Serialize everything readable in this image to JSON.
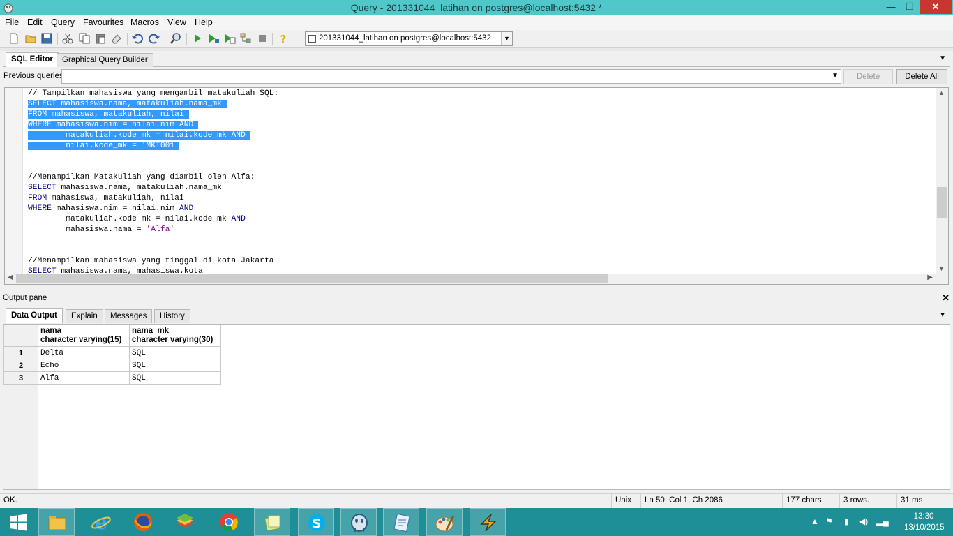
{
  "window": {
    "title": "Query - 201331044_latihan on postgres@localhost:5432 *",
    "minimize": "—",
    "maximize": "❐",
    "close": "✕"
  },
  "menu": [
    "File",
    "Edit",
    "Query",
    "Favourites",
    "Macros",
    "View",
    "Help"
  ],
  "toolbar": {
    "icons": [
      "new-icon",
      "open-icon",
      "save-icon",
      "cut-icon",
      "copy-icon",
      "paste-icon",
      "clear-icon",
      "undo-icon",
      "redo-icon",
      "find-icon",
      "execute-icon",
      "execute-pgscript-icon",
      "execute-to-file-icon",
      "explain-icon",
      "cancel-icon",
      "help-icon"
    ],
    "connection": "201331044_latihan on postgres@localhost:5432"
  },
  "editor_tabs": [
    "SQL Editor",
    "Graphical Query Builder"
  ],
  "previous_queries": {
    "label": "Previous queries",
    "value": "",
    "delete": "Delete",
    "delete_all": "Delete All"
  },
  "editor": {
    "lines": [
      {
        "segments": [
          {
            "t": "// Tampilkan mahasiswa yang mengambil matakuliah SQL:",
            "c": "plain"
          }
        ]
      },
      {
        "segments": [
          {
            "t": "SELECT",
            "c": "kw sel"
          },
          {
            "t": " mahasiswa.nama, matakuliah.nama_mk ",
            "c": "sel"
          }
        ]
      },
      {
        "segments": [
          {
            "t": "FROM",
            "c": "kw sel"
          },
          {
            "t": " mahasiswa, matakuliah, nilai ",
            "c": "sel"
          }
        ]
      },
      {
        "segments": [
          {
            "t": "WHERE",
            "c": "kw sel"
          },
          {
            "t": " mahasiswa.nim = nilai.nim ",
            "c": "sel"
          },
          {
            "t": "AND",
            "c": "kw sel"
          },
          {
            "t": " ",
            "c": "sel"
          }
        ]
      },
      {
        "segments": [
          {
            "t": "        matakuliah.kode_mk = nilai.kode_mk ",
            "c": "sel"
          },
          {
            "t": "AND",
            "c": "kw sel"
          },
          {
            "t": " ",
            "c": "sel"
          }
        ]
      },
      {
        "segments": [
          {
            "t": "        nilai.kode_mk = 'MKI001'",
            "c": "sel"
          }
        ]
      },
      {
        "segments": []
      },
      {
        "segments": []
      },
      {
        "segments": [
          {
            "t": "//Menampilkan Matakuliah yang diambil oleh Alfa:",
            "c": "plain"
          }
        ]
      },
      {
        "segments": [
          {
            "t": "SELECT",
            "c": "kw"
          },
          {
            "t": " mahasiswa.nama, matakuliah.nama_mk",
            "c": "plain"
          }
        ]
      },
      {
        "segments": [
          {
            "t": "FROM",
            "c": "kw"
          },
          {
            "t": " mahasiswa, matakuliah, nilai",
            "c": "plain"
          }
        ]
      },
      {
        "segments": [
          {
            "t": "WHERE",
            "c": "kw"
          },
          {
            "t": " mahasiswa.nim = nilai.nim ",
            "c": "plain"
          },
          {
            "t": "AND",
            "c": "kw"
          }
        ]
      },
      {
        "segments": [
          {
            "t": "        matakuliah.kode_mk = nilai.kode_mk ",
            "c": "plain"
          },
          {
            "t": "AND",
            "c": "kw"
          }
        ]
      },
      {
        "segments": [
          {
            "t": "        mahasiswa.nama = ",
            "c": "plain"
          },
          {
            "t": "'Alfa'",
            "c": "str"
          }
        ]
      },
      {
        "segments": []
      },
      {
        "segments": []
      },
      {
        "segments": [
          {
            "t": "//Menampilkan mahasiswa yang tinggal di kota Jakarta",
            "c": "plain"
          }
        ]
      },
      {
        "segments": [
          {
            "t": "SELECT",
            "c": "kw"
          },
          {
            "t": " mahasiswa.nama, mahasiswa.kota",
            "c": "plain"
          }
        ]
      }
    ]
  },
  "output": {
    "header": "Output pane",
    "close": "✕",
    "tabs": [
      "Data Output",
      "Explain",
      "Messages",
      "History"
    ],
    "columns": [
      {
        "name": "nama",
        "type": "character varying(15)"
      },
      {
        "name": "nama_mk",
        "type": "character varying(30)"
      }
    ],
    "rows": [
      {
        "n": "1",
        "nama": "Delta",
        "nama_mk": "SQL"
      },
      {
        "n": "2",
        "nama": "Echo",
        "nama_mk": "SQL"
      },
      {
        "n": "3",
        "nama": "Alfa",
        "nama_mk": "SQL"
      }
    ]
  },
  "status": {
    "message": "OK.",
    "line_ending": "Unix",
    "position": "Ln 50, Col 1, Ch 2086",
    "chars": "177 chars",
    "rows": "3 rows.",
    "time": "31 ms"
  },
  "taskbar": {
    "apps": [
      "start-icon",
      "file-explorer-icon",
      "internet-explorer-icon",
      "firefox-icon",
      "bluestacks-icon",
      "chrome-icon",
      "notepad-app-icon",
      "skype-icon",
      "pgadmin-icon",
      "editor-app-icon",
      "paint-icon",
      "winamp-icon"
    ],
    "time": "13:30",
    "date": "13/10/2015"
  },
  "colors": {
    "titlebar": "#50c8c9",
    "taskbar": "#1e8f96",
    "selection": "#3399ff",
    "keyword": "#00007f",
    "string": "#7f007f"
  }
}
